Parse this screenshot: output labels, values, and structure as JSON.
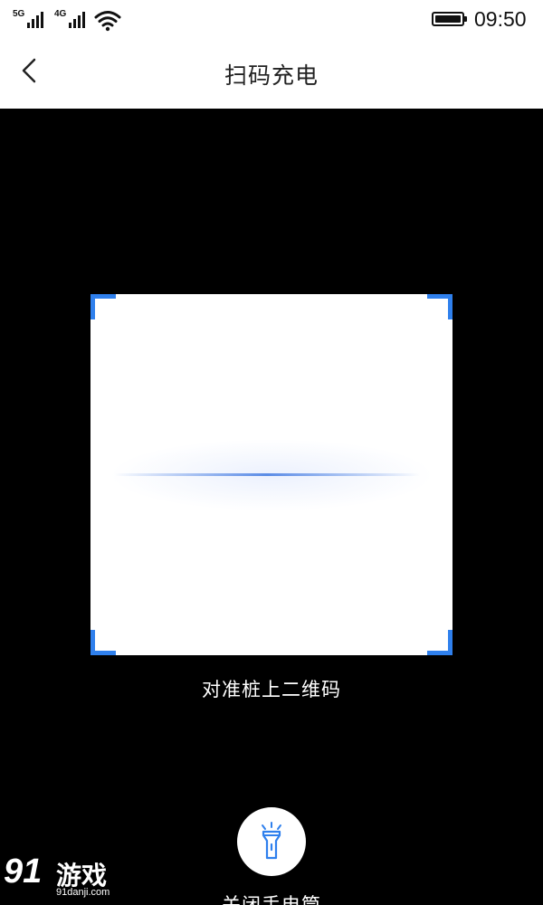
{
  "status_bar": {
    "signal_1_label": "5G",
    "signal_2_label": "4G",
    "time": "09:50",
    "battery_icon": "battery-full-icon",
    "wifi_icon": "wifi-icon"
  },
  "nav": {
    "back_icon": "chevron-left-icon",
    "title": "扫码充电"
  },
  "scanner": {
    "accent_color": "#2f80ed",
    "hint": "对准桩上二维码"
  },
  "flashlight": {
    "icon": "flashlight-icon",
    "label": "关闭手电筒"
  },
  "watermark": {
    "number": "91",
    "name": "游戏",
    "url": "91danji.com"
  }
}
